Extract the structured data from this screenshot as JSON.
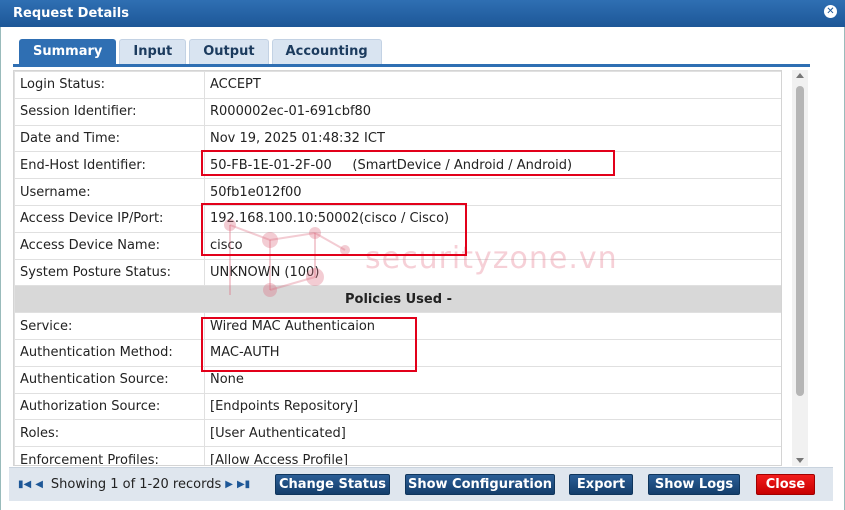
{
  "dialog": {
    "title": "Request Details"
  },
  "tabs": [
    "Summary",
    "Input",
    "Output",
    "Accounting"
  ],
  "rows_top": [
    {
      "key": "Login Status:",
      "value": "ACCEPT"
    },
    {
      "key": "Session Identifier:",
      "value": "R000002ec-01-691cbf80"
    },
    {
      "key": "Date and Time:",
      "value": "Nov 19, 2025 01:48:32 ICT"
    },
    {
      "key": "End-Host Identifier:",
      "value": "50-FB-1E-01-2F-00     (SmartDevice / Android / Android)"
    },
    {
      "key": "Username:",
      "value": "50fb1e012f00"
    },
    {
      "key": "Access Device IP/Port:",
      "value": "192.168.100.10:50002(cisco / Cisco)"
    },
    {
      "key": "Access Device Name:",
      "value": "cisco"
    },
    {
      "key": "System Posture Status:",
      "value": "UNKNOWN (100)"
    }
  ],
  "section_header": "Policies Used -",
  "rows_policies": [
    {
      "key": "Service:",
      "value": "Wired MAC Authenticaion"
    },
    {
      "key": "Authentication Method:",
      "value": "MAC-AUTH"
    },
    {
      "key": "Authentication Source:",
      "value": "None"
    },
    {
      "key": "Authorization Source:",
      "value": "[Endpoints Repository]"
    },
    {
      "key": "Roles:",
      "value": "[User Authenticated]"
    },
    {
      "key": "Enforcement Profiles:",
      "value": "[Allow Access Profile]"
    }
  ],
  "watermark": {
    "text": "securityzone.vn"
  },
  "footer": {
    "pager_text": "Showing 1 of 1-20 records",
    "buttons": {
      "change_status": "Change Status",
      "show_configuration": "Show Configuration",
      "export": "Export",
      "show_logs": "Show Logs",
      "close": "Close"
    }
  },
  "icons": {
    "first": "first-page-icon",
    "prev": "prev-page-icon",
    "next": "next-page-icon",
    "last": "last-page-icon",
    "close_dialog": "close-icon"
  },
  "colors": {
    "title_bar": "#1d5797",
    "highlight": "#e2001a",
    "close_button": "#e00000"
  }
}
